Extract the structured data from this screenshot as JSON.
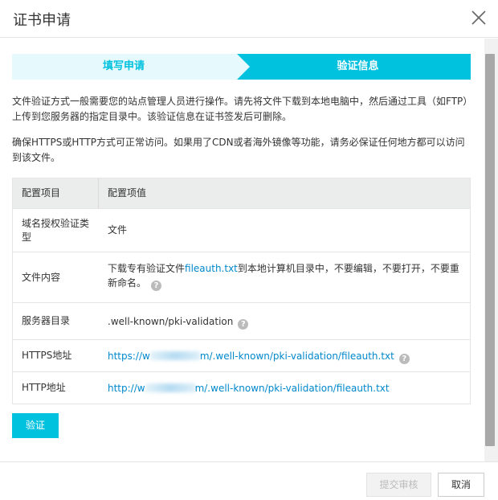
{
  "dialog": {
    "title": "证书申请"
  },
  "steps": [
    {
      "label": "填写申请",
      "state": "done"
    },
    {
      "label": "验证信息",
      "state": "active"
    }
  ],
  "colors": {
    "accent": "#00c1de",
    "step_done_bg": "#e6fafd",
    "link": "#0088cc"
  },
  "description": {
    "para1": "文件验证方式一般需要您的站点管理人员进行操作。请先将文件下载到本地电脑中，然后通过工具（如FTP）上传到您服务器的指定目录中。该验证信息在证书签发后可删除。",
    "para2": "确保HTTPS或HTTP方式可正常访问。如果用了CDN或者海外镜像等功能，请务必保证任何地方都可以访问到该文件。"
  },
  "table": {
    "headers": [
      "配置项目",
      "配置项值"
    ],
    "rows": {
      "auth_type": {
        "label": "域名授权验证类型",
        "value": "文件"
      },
      "file_content": {
        "label": "文件内容",
        "value_prefix": "下载专有验证文件",
        "file_link": "fileauth.txt",
        "value_suffix": "到本地计算机目录中，不要编辑，不要打开，不要重新命名。"
      },
      "server_dir": {
        "label": "服务器目录",
        "value": ".well-known/pki-validation"
      },
      "https_url": {
        "label": "HTTPS地址",
        "prefix": "https://w",
        "suffix": "m/.well-known/pki-validation/fileauth.txt"
      },
      "http_url": {
        "label": "HTTP地址",
        "prefix": "http://w",
        "suffix": "m/.well-known/pki-validation/fileauth.txt"
      }
    }
  },
  "buttons": {
    "verify": "验证",
    "submit": "提交审核",
    "cancel": "取消"
  }
}
